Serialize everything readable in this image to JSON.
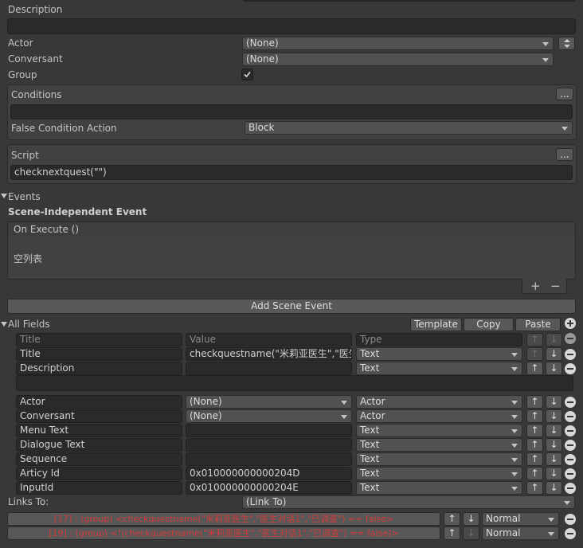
{
  "description": {
    "label": "Description",
    "value": ""
  },
  "actor": {
    "label": "Actor",
    "value": "(None)"
  },
  "conversant": {
    "label": "Conversant",
    "value": "(None)"
  },
  "group": {
    "label": "Group",
    "checked": true
  },
  "conditions": {
    "label": "Conditions",
    "ellipsis": "...",
    "value": "",
    "false_action_label": "False Condition Action",
    "false_action_value": "Block"
  },
  "script": {
    "label": "Script",
    "ellipsis": "...",
    "value": "checknextquest(\"\")"
  },
  "events": {
    "label": "Events",
    "scene_independent_label": "Scene-Independent Event",
    "on_execute_label": "On Execute ()",
    "empty_list": "空列表",
    "plus": "+",
    "minus": "−",
    "add_scene_event": "Add Scene Event"
  },
  "all_fields": {
    "label": "All Fields",
    "template_btn": "Template",
    "copy_btn": "Copy",
    "paste_btn": "Paste",
    "headers": {
      "title": "Title",
      "value": "Value",
      "type": "Type"
    },
    "rows": [
      {
        "title": "Title",
        "value": "checkquestname(\"米莉亚医生\",\"医生",
        "type": "Text",
        "value_dropdown": false
      },
      {
        "title": "Description",
        "value": "",
        "type": "Text",
        "value_dropdown": false
      },
      {
        "title": "Actor",
        "value": "(None)",
        "type": "Actor",
        "value_dropdown": true
      },
      {
        "title": "Conversant",
        "value": "(None)",
        "type": "Actor",
        "value_dropdown": true
      },
      {
        "title": "Menu Text",
        "value": "",
        "type": "Text",
        "value_dropdown": false
      },
      {
        "title": "Dialogue Text",
        "value": "",
        "type": "Text",
        "value_dropdown": false
      },
      {
        "title": "Sequence",
        "value": "",
        "type": "Text",
        "value_dropdown": false
      },
      {
        "title": "Articy Id",
        "value": "0x010000000000204D",
        "type": "Text",
        "value_dropdown": false
      },
      {
        "title": "InputId",
        "value": "0x010000000000204E",
        "type": "Text",
        "value_dropdown": false
      }
    ]
  },
  "links": {
    "label": "Links To:",
    "value": "(Link To)",
    "items": [
      {
        "text": "[17] : (group) <checkquestname(\"米莉亚医生\",\"医生对话1\",\"已调查\") == false>",
        "priority": "Normal"
      },
      {
        "text": "[19] : (group) <!(checkquestname(\"米莉亚医生\",\"医生对话1\",\"已调查\") == false)>",
        "priority": "Normal"
      }
    ]
  },
  "arrows": {
    "up": "↑",
    "down": "↓"
  },
  "colors": {
    "panel": "#383838",
    "field": "#2a2a2a",
    "button": "#585858",
    "link_red": "#d23c3c"
  }
}
